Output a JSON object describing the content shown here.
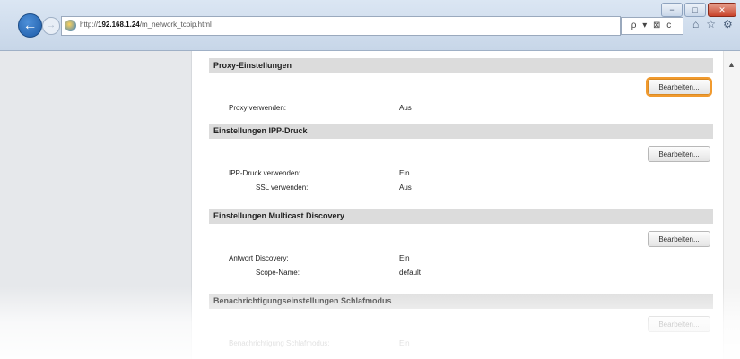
{
  "browser": {
    "url_prefix": "http://",
    "url_host": "192.168.1.24",
    "url_path": "/m_network_tcpip.html",
    "addr_tools": "ρ ▾ ⊠ c",
    "window_min": "−",
    "window_max": "□",
    "window_close": "✕"
  },
  "sections": [
    {
      "title": "Proxy-Einstellungen",
      "button": "Bearbeiten...",
      "rows": [
        {
          "label": "Proxy verwenden:",
          "value": "Aus"
        }
      ]
    },
    {
      "title": "Einstellungen IPP-Druck",
      "button": "Bearbeiten...",
      "rows": [
        {
          "label": "IPP-Druck verwenden:",
          "value": "Ein"
        },
        {
          "label": "SSL verwenden:",
          "value": "Aus"
        }
      ]
    },
    {
      "title": "Einstellungen Multicast Discovery",
      "button": "Bearbeiten...",
      "rows": [
        {
          "label": "Antwort Discovery:",
          "value": "Ein"
        },
        {
          "label": "Scope-Name:",
          "value": "default"
        }
      ]
    },
    {
      "title": "Benachrichtigungseinstellungen Schlafmodus",
      "button": "Bearbeiten...",
      "rows": [
        {
          "label": "Benachrichtigung Schlafmodus:",
          "value": "Ein"
        }
      ]
    }
  ],
  "colors": {
    "focus_ring": "#f19a2e",
    "section_header": "#dcdcdc"
  }
}
